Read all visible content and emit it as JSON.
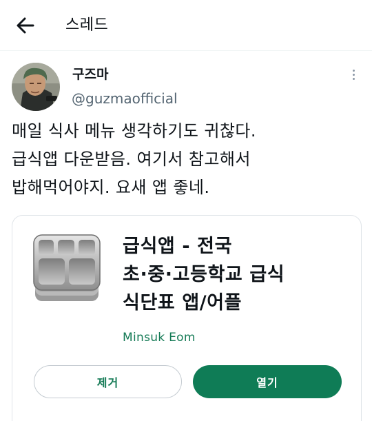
{
  "header": {
    "title": "스레드",
    "back_icon": "arrow-left-icon"
  },
  "tweet": {
    "display_name": "구즈마",
    "handle": "@guzmaofficial",
    "more_icon": "vertical-ellipsis-icon",
    "text_lines": [
      "매일 식사 메뉴 생각하기도 귀찮다.",
      "급식앱 다운받음. 여기서 참고해서",
      "밥해먹어야지. 요새 앱 좋네."
    ]
  },
  "app_card": {
    "icon": "lunch-tray-icon",
    "title_lines": [
      "급식앱 - 전국",
      "초·중·고등학교 급식",
      "식단표 앱/어플"
    ],
    "developer": "Minsuk Eom",
    "remove_label": "제거",
    "open_label": "열기",
    "accent_color": "#0f7c56"
  }
}
